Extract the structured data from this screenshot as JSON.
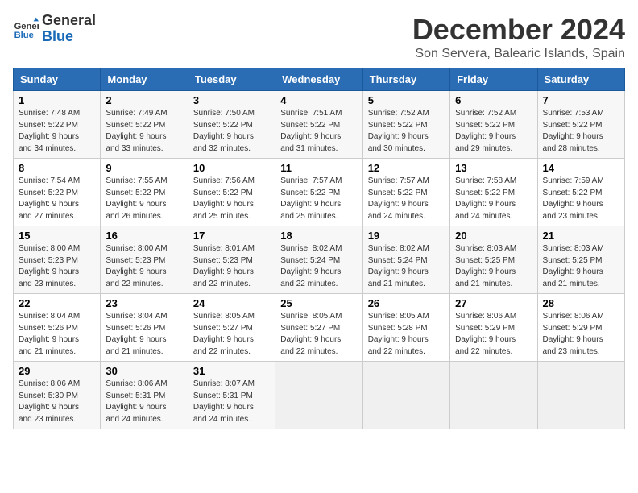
{
  "header": {
    "logo_line1": "General",
    "logo_line2": "Blue",
    "month": "December 2024",
    "location": "Son Servera, Balearic Islands, Spain"
  },
  "weekdays": [
    "Sunday",
    "Monday",
    "Tuesday",
    "Wednesday",
    "Thursday",
    "Friday",
    "Saturday"
  ],
  "weeks": [
    [
      {
        "day": "1",
        "rise": "7:48 AM",
        "set": "5:22 PM",
        "hours": "9 hours",
        "mins": "34 minutes"
      },
      {
        "day": "2",
        "rise": "7:49 AM",
        "set": "5:22 PM",
        "hours": "9 hours",
        "mins": "33 minutes"
      },
      {
        "day": "3",
        "rise": "7:50 AM",
        "set": "5:22 PM",
        "hours": "9 hours",
        "mins": "32 minutes"
      },
      {
        "day": "4",
        "rise": "7:51 AM",
        "set": "5:22 PM",
        "hours": "9 hours",
        "mins": "31 minutes"
      },
      {
        "day": "5",
        "rise": "7:52 AM",
        "set": "5:22 PM",
        "hours": "9 hours",
        "mins": "30 minutes"
      },
      {
        "day": "6",
        "rise": "7:52 AM",
        "set": "5:22 PM",
        "hours": "9 hours",
        "mins": "29 minutes"
      },
      {
        "day": "7",
        "rise": "7:53 AM",
        "set": "5:22 PM",
        "hours": "9 hours",
        "mins": "28 minutes"
      }
    ],
    [
      {
        "day": "8",
        "rise": "7:54 AM",
        "set": "5:22 PM",
        "hours": "9 hours",
        "mins": "27 minutes"
      },
      {
        "day": "9",
        "rise": "7:55 AM",
        "set": "5:22 PM",
        "hours": "9 hours",
        "mins": "26 minutes"
      },
      {
        "day": "10",
        "rise": "7:56 AM",
        "set": "5:22 PM",
        "hours": "9 hours",
        "mins": "25 minutes"
      },
      {
        "day": "11",
        "rise": "7:57 AM",
        "set": "5:22 PM",
        "hours": "9 hours",
        "mins": "25 minutes"
      },
      {
        "day": "12",
        "rise": "7:57 AM",
        "set": "5:22 PM",
        "hours": "9 hours",
        "mins": "24 minutes"
      },
      {
        "day": "13",
        "rise": "7:58 AM",
        "set": "5:22 PM",
        "hours": "9 hours",
        "mins": "24 minutes"
      },
      {
        "day": "14",
        "rise": "7:59 AM",
        "set": "5:22 PM",
        "hours": "9 hours",
        "mins": "23 minutes"
      }
    ],
    [
      {
        "day": "15",
        "rise": "8:00 AM",
        "set": "5:23 PM",
        "hours": "9 hours",
        "mins": "23 minutes"
      },
      {
        "day": "16",
        "rise": "8:00 AM",
        "set": "5:23 PM",
        "hours": "9 hours",
        "mins": "22 minutes"
      },
      {
        "day": "17",
        "rise": "8:01 AM",
        "set": "5:23 PM",
        "hours": "9 hours",
        "mins": "22 minutes"
      },
      {
        "day": "18",
        "rise": "8:02 AM",
        "set": "5:24 PM",
        "hours": "9 hours",
        "mins": "22 minutes"
      },
      {
        "day": "19",
        "rise": "8:02 AM",
        "set": "5:24 PM",
        "hours": "9 hours",
        "mins": "21 minutes"
      },
      {
        "day": "20",
        "rise": "8:03 AM",
        "set": "5:25 PM",
        "hours": "9 hours",
        "mins": "21 minutes"
      },
      {
        "day": "21",
        "rise": "8:03 AM",
        "set": "5:25 PM",
        "hours": "9 hours",
        "mins": "21 minutes"
      }
    ],
    [
      {
        "day": "22",
        "rise": "8:04 AM",
        "set": "5:26 PM",
        "hours": "9 hours",
        "mins": "21 minutes"
      },
      {
        "day": "23",
        "rise": "8:04 AM",
        "set": "5:26 PM",
        "hours": "9 hours",
        "mins": "21 minutes"
      },
      {
        "day": "24",
        "rise": "8:05 AM",
        "set": "5:27 PM",
        "hours": "9 hours",
        "mins": "22 minutes"
      },
      {
        "day": "25",
        "rise": "8:05 AM",
        "set": "5:27 PM",
        "hours": "9 hours",
        "mins": "22 minutes"
      },
      {
        "day": "26",
        "rise": "8:05 AM",
        "set": "5:28 PM",
        "hours": "9 hours",
        "mins": "22 minutes"
      },
      {
        "day": "27",
        "rise": "8:06 AM",
        "set": "5:29 PM",
        "hours": "9 hours",
        "mins": "22 minutes"
      },
      {
        "day": "28",
        "rise": "8:06 AM",
        "set": "5:29 PM",
        "hours": "9 hours",
        "mins": "23 minutes"
      }
    ],
    [
      {
        "day": "29",
        "rise": "8:06 AM",
        "set": "5:30 PM",
        "hours": "9 hours",
        "mins": "23 minutes"
      },
      {
        "day": "30",
        "rise": "8:06 AM",
        "set": "5:31 PM",
        "hours": "9 hours",
        "mins": "24 minutes"
      },
      {
        "day": "31",
        "rise": "8:07 AM",
        "set": "5:31 PM",
        "hours": "9 hours",
        "mins": "24 minutes"
      },
      null,
      null,
      null,
      null
    ]
  ]
}
